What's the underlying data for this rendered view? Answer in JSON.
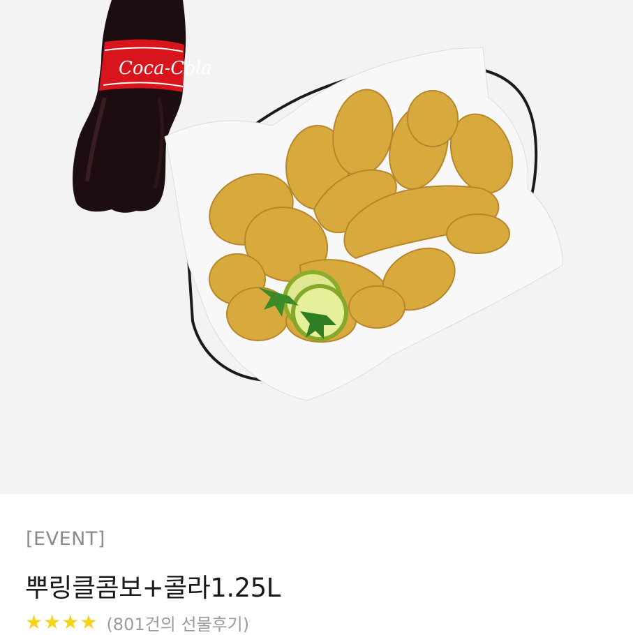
{
  "product": {
    "category": "[EVENT]",
    "name": "뿌링클콤보+콜라1.25L",
    "rating": {
      "stars": 4,
      "max": 4,
      "star_color": "#f5d21c"
    },
    "review_text": "(801건의 선물후기)",
    "image": {
      "items": [
        "cola-bottle",
        "fried-chicken-basket"
      ],
      "bottle_label": "Coca-Cola"
    }
  }
}
